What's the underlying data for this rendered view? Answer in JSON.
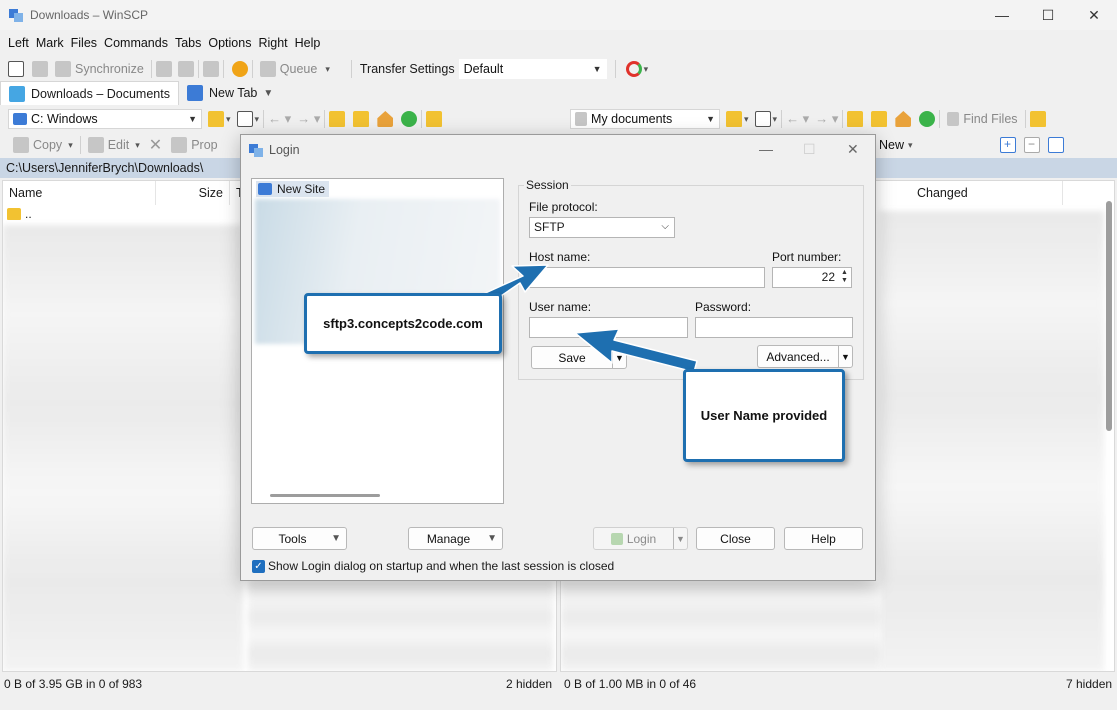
{
  "window": {
    "title": "Downloads – WinSCP",
    "minimize": "—",
    "maximize": "☐",
    "close": "✕"
  },
  "menu": [
    "Left",
    "Mark",
    "Files",
    "Commands",
    "Tabs",
    "Options",
    "Right",
    "Help"
  ],
  "toolbar": {
    "synchronize": "Synchronize",
    "queue": "Queue",
    "transfer_settings_label": "Transfer Settings",
    "transfer_settings_value": "Default"
  },
  "tabs": [
    "Downloads – Documents",
    "New Tab"
  ],
  "left_panel": {
    "drive": "C: Windows",
    "copy": "Copy",
    "edit": "Edit",
    "prop": "Prop",
    "path": "C:\\Users\\JenniferBrych\\Downloads\\",
    "columns": [
      "Name",
      "Size",
      "T"
    ],
    "parent_row": "..",
    "status_left": "0 B of 3.95 GB in 0 of 983",
    "status_right": "2 hidden"
  },
  "right_panel": {
    "location": "My documents",
    "find_files": "Find Files",
    "new": "New",
    "columns": [
      "Changed"
    ],
    "status_left": "0 B of 1.00 MB in 0 of 46",
    "status_right": "7 hidden"
  },
  "login": {
    "title": "Login",
    "site": "New Site",
    "session_label": "Session",
    "file_protocol_label": "File protocol:",
    "file_protocol_value": "SFTP",
    "host_name_label": "Host name:",
    "host_name_value": "",
    "port_label": "Port number:",
    "port_value": "22",
    "user_name_label": "User name:",
    "user_name_value": "",
    "password_label": "Password:",
    "password_value": "",
    "save": "Save",
    "advanced": "Advanced...",
    "tools": "Tools",
    "manage": "Manage",
    "login_btn": "Login",
    "close_btn": "Close",
    "help_btn": "Help",
    "show_login_checkbox": "Show Login dialog on startup and when the last session is closed"
  },
  "annotations": {
    "host_callout": "sftp3.concepts2code.com",
    "user_callout": "User Name provided",
    "color": "#1e6fb0"
  }
}
